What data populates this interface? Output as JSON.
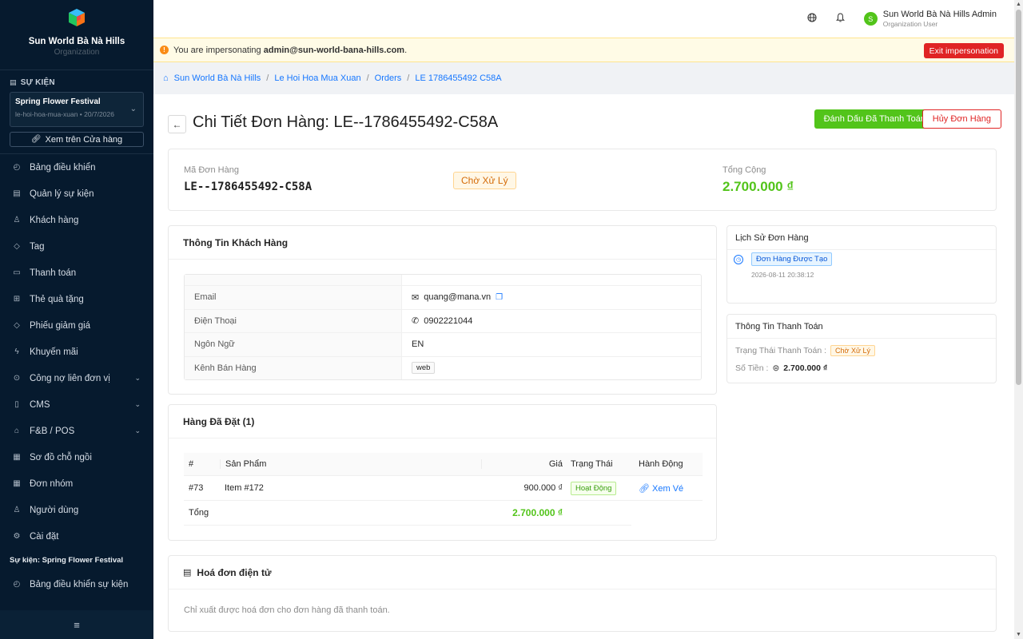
{
  "sidebar": {
    "brand_name": "Sun World Bà Nà Hills",
    "brand_sub": "Organization",
    "section_label": "SỰ KIỆN",
    "event": {
      "name": "Spring Flower Festival",
      "meta": "le-hoi-hoa-mua-xuan • 20/7/2026"
    },
    "store_button": "Xem trên Cửa hàng",
    "menu": [
      {
        "label": "Bảng điều khiển",
        "icon": "dashboard-icon",
        "glyph": "◴"
      },
      {
        "label": "Quản lý sự kiện",
        "icon": "calendar-icon",
        "glyph": "▤"
      },
      {
        "label": "Khách hàng",
        "icon": "user-icon",
        "glyph": "♙"
      },
      {
        "label": "Tag",
        "icon": "tag-icon",
        "glyph": "◇"
      },
      {
        "label": "Thanh toán",
        "icon": "payment-icon",
        "glyph": "▭"
      },
      {
        "label": "Thẻ quà tặng",
        "icon": "gift-icon",
        "glyph": "⊞"
      },
      {
        "label": "Phiếu giảm giá",
        "icon": "coupon-icon",
        "glyph": "◇"
      },
      {
        "label": "Khuyến mãi",
        "icon": "thunder-icon",
        "glyph": "ϟ"
      },
      {
        "label": "Công nợ liên đơn vị",
        "icon": "debt-icon",
        "glyph": "⊙",
        "chevron": true
      },
      {
        "label": "CMS",
        "icon": "file-icon",
        "glyph": "▯",
        "chevron": true
      },
      {
        "label": "F&B / POS",
        "icon": "shop-icon",
        "glyph": "⌂",
        "chevron": true
      },
      {
        "label": "Sơ đồ chỗ ngồi",
        "icon": "seat-map-icon",
        "glyph": "▦"
      },
      {
        "label": "Đơn nhóm",
        "icon": "group-icon",
        "glyph": "▦"
      },
      {
        "label": "Người dùng",
        "icon": "users-icon",
        "glyph": "♙"
      },
      {
        "label": "Cài đặt",
        "icon": "settings-icon",
        "glyph": "⚙"
      }
    ],
    "event_section_title": "Sự kiện: Spring Flower Festival",
    "event_menu": [
      {
        "label": "Bảng điều khiển sự kiện",
        "icon": "dashboard-icon",
        "glyph": "◴"
      }
    ],
    "collapse_icon": "≡"
  },
  "topbar": {
    "user_name": "Sun World Bà Nà Hills Admin",
    "user_role": "Organization User",
    "avatar_letter": "S"
  },
  "banner": {
    "prefix": "You are impersonating ",
    "email": "admin@sun-world-bana-hills.com",
    "suffix": ".",
    "exit_label": "Exit impersonation"
  },
  "breadcrumb": [
    "Sun World Bà Nà Hills",
    "Le Hoi Hoa Mua Xuan",
    "Orders",
    "LE 1786455492 C58A"
  ],
  "page": {
    "title": "Chi Tiết Đơn Hàng: LE--1786455492-C58A",
    "mark_paid_label": "Đánh Dấu Đã Thanh Toán",
    "cancel_label": "Hủy Đơn Hàng"
  },
  "summary": {
    "code_label": "Mã Đơn Hàng",
    "code": "LE--1786455492-C58A",
    "status": "Chờ Xử Lý",
    "total_label": "Tổng Cộng",
    "total": "2.700.000 ₫"
  },
  "customer": {
    "title": "Thông Tin Khách Hàng",
    "rows": [
      {
        "key": "Email",
        "value": "quang@mana.vn"
      },
      {
        "key": "Điện Thoại",
        "value": "0902221044"
      },
      {
        "key": "Ngôn Ngữ",
        "value": "EN"
      },
      {
        "key": "Kênh Bán Hàng",
        "value": "web"
      }
    ]
  },
  "items": {
    "title": "Hàng Đã Đặt (1)",
    "headers": [
      "#",
      "Sản Phẩm",
      "Giá",
      "Trạng Thái",
      "Hành Động"
    ],
    "rows": [
      {
        "num": "#73",
        "product": "Item #172",
        "price": "900.000 ₫",
        "status": "Hoạt Động",
        "action": "Xem Vé"
      }
    ],
    "total_label": "Tổng",
    "total_value": "2.700.000 ₫"
  },
  "history": {
    "title": "Lịch Sử Đơn Hàng",
    "entry_label": "Đơn Hàng Được Tạo",
    "entry_time": "2026-08-11 20:38:12"
  },
  "payment": {
    "title": "Thông Tin Thanh Toán",
    "status_label": "Trạng Thái Thanh Toán :",
    "status": "Chờ Xử Lý",
    "amount_label": "Số Tiền :",
    "amount": "2.700.000 ₫"
  },
  "invoice": {
    "title": "Hoá đơn điện tử",
    "note": "Chỉ xuất được hoá đơn cho đơn hàng đã thanh toán."
  },
  "colors": {
    "sidebar_bg": "#061a2e",
    "success": "#52c41a",
    "danger": "#e02424",
    "link": "#1677ff"
  }
}
